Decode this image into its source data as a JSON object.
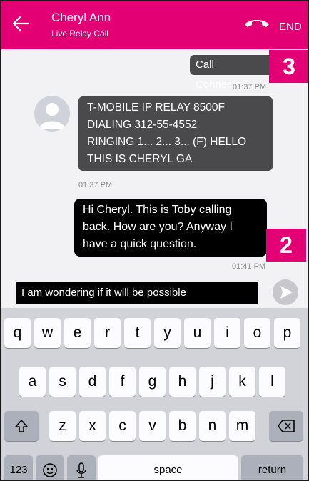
{
  "header": {
    "contact_name": "Cheryl Ann",
    "call_type": "Live Relay Call",
    "end_label": "END",
    "accent_color": "#e20074",
    "icons": [
      "back-arrow-icon",
      "hang-up-icon"
    ]
  },
  "messages": [
    {
      "direction": "outgoing",
      "text": "Call Connected.",
      "time": "01:37 PM"
    },
    {
      "direction": "incoming",
      "lines": [
        "T-MOBILE IP RELAY 8500F",
        "DIALING 312-55-4552",
        "RINGING 1... 2... 3... (F) HELLO",
        "THIS IS CHERYL GA"
      ],
      "time": "01:37 PM"
    },
    {
      "direction": "outgoing",
      "lines": [
        "Hi Cheryl.  This is Toby calling",
        "back.  How are you? Anyway I",
        "have a quick question."
      ],
      "time": "01:41 PM"
    }
  ],
  "composer": {
    "text": "I am wondering if it will be possible",
    "send_icon": "send-arrow-icon"
  },
  "keyboard": {
    "row1": [
      "q",
      "w",
      "e",
      "r",
      "t",
      "y",
      "u",
      "i",
      "o",
      "p"
    ],
    "row2": [
      "a",
      "s",
      "d",
      "f",
      "g",
      "h",
      "j",
      "k",
      "l"
    ],
    "row3": [
      "z",
      "x",
      "c",
      "v",
      "b",
      "n",
      "m"
    ],
    "shift_icon": "shift-icon",
    "backspace_icon": "backspace-icon",
    "numbers_label": "123",
    "emoji_icon": "emoji-icon",
    "mic_icon": "microphone-icon",
    "space_label": "space",
    "return_label": "return"
  },
  "callouts": {
    "keyboard_marker": "1",
    "message_marker": "2",
    "status_marker": "3"
  }
}
